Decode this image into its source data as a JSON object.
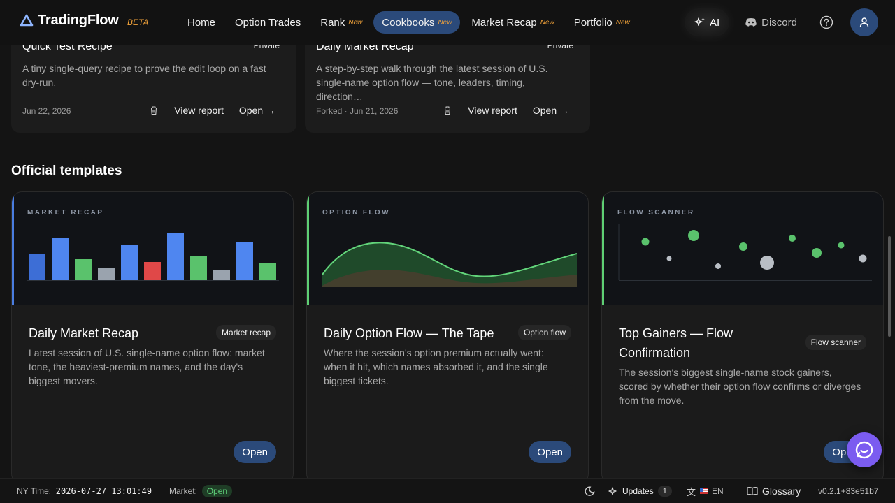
{
  "nav": {
    "brand": "TradingFlow",
    "beta": "BETA",
    "items": [
      {
        "label": "Home",
        "new": ""
      },
      {
        "label": "Option Trades",
        "new": ""
      },
      {
        "label": "Rank",
        "new": "New"
      },
      {
        "label": "Cookbooks",
        "new": "New"
      },
      {
        "label": "Market Recap",
        "new": "New"
      },
      {
        "label": "Portfolio",
        "new": "New"
      }
    ],
    "active": "Cookbooks",
    "ai": "AI",
    "discord": "Discord"
  },
  "recipes": [
    {
      "title": "Quick Test Recipe",
      "badge": "Private",
      "desc": "A tiny single-query recipe to prove the edit loop on a fast dry-run.",
      "date": "Jun 22, 2026",
      "view": "View report",
      "open": "Open"
    },
    {
      "title": "Daily Market Recap",
      "badge": "Private",
      "desc": "A step-by-step walk through the latest session of U.S. single-name option flow — tone, leaders, timing, direction…",
      "date": "Forked · Jun 21, 2026",
      "view": "View report",
      "open": "Open"
    }
  ],
  "section_title": "Official templates",
  "templates": [
    {
      "kicker": "MARKET RECAP",
      "title": "Daily Market Recap",
      "tag": "Market recap",
      "desc": "Latest session of U.S. single-name option flow: market tone, the heaviest-premium names, and the day's biggest movers.",
      "open": "Open",
      "accent": "#4a7de0"
    },
    {
      "kicker": "OPTION FLOW",
      "title": "Daily Option Flow — The Tape",
      "tag": "Option flow",
      "desc": "Where the session's option premium actually went: when it hit, which names absorbed it, and the single biggest tickets.",
      "open": "Open",
      "accent": "#5fcf74"
    },
    {
      "kicker": "FLOW SCANNER",
      "title": "Top Gainers — Flow Confirmation",
      "tag": "Flow scanner",
      "desc": "The session's biggest single-name stock gainers, scored by whether their option flow confirms or diverges from the move.",
      "open": "Open",
      "accent": "#5fcf74"
    }
  ],
  "status": {
    "ny_label": "NY Time:",
    "ny_time": "2026-07-27 13:01:49",
    "market_label": "Market:",
    "market_state": "Open",
    "updates": "Updates",
    "updates_count": "1",
    "lang": "EN",
    "glossary": "Glossary",
    "version": "v0.2.1+83e51b7"
  }
}
